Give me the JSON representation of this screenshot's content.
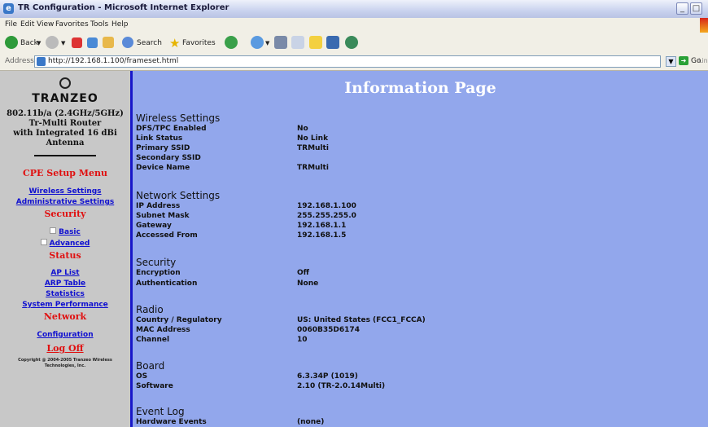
{
  "window": {
    "title": "TR Configuration - Microsoft Internet Explorer",
    "menu": [
      "File",
      "Edit",
      "View",
      "Favorites",
      "Tools",
      "Help"
    ]
  },
  "toolbar": {
    "back": "Back",
    "search": "Search",
    "favorites": "Favorites"
  },
  "address": {
    "label": "Address",
    "url": "http://192.168.1.100/frameset.html",
    "go": "Go",
    "links": "Links"
  },
  "sidebar": {
    "logo": "TRANZEO",
    "product": [
      "802.11b/a (2.4GHz/5GHz)",
      "Tr-Multi Router",
      "with Integrated 16 dBi",
      "Antenna"
    ],
    "cpe_heading": "CPE Setup Menu",
    "wireless_settings": "Wireless Settings",
    "administrative_settings": "Administrative Settings",
    "security_heading": "Security",
    "basic": "Basic",
    "advanced": "Advanced",
    "status_heading": "Status",
    "ap_list": "AP List",
    "arp_table": "ARP Table",
    "statistics": "Statistics",
    "system_performance": "System Performance",
    "network_heading": "Network",
    "configuration": "Configuration",
    "log_off": "Log Off",
    "copyright": [
      "Copyright @ 2004-2005 Tranzeo Wireless",
      "Technologies, Inc."
    ]
  },
  "main": {
    "title": "Information Page",
    "sections": {
      "wireless": {
        "heading": "Wireless Settings",
        "rows": [
          {
            "label": "DFS/TPC Enabled",
            "value": "No"
          },
          {
            "label": "Link Status",
            "value": "No Link"
          },
          {
            "label": "Primary SSID",
            "value": "TRMulti"
          },
          {
            "label": "Secondary SSID",
            "value": ""
          },
          {
            "label": "Device Name",
            "value": "TRMulti"
          }
        ]
      },
      "network": {
        "heading": "Network Settings",
        "rows": [
          {
            "label": "IP Address",
            "value": "192.168.1.100"
          },
          {
            "label": "Subnet Mask",
            "value": "255.255.255.0"
          },
          {
            "label": "Gateway",
            "value": "192.168.1.1"
          },
          {
            "label": "Accessed From",
            "value": "192.168.1.5"
          }
        ]
      },
      "security": {
        "heading": "Security",
        "rows": [
          {
            "label": "Encryption",
            "value": "Off"
          },
          {
            "label": "Authentication",
            "value": "None"
          }
        ]
      },
      "radio": {
        "heading": "Radio",
        "rows": [
          {
            "label": "Country / Regulatory",
            "value": "US: United States (FCC1_FCCA)"
          },
          {
            "label": "MAC Address",
            "value": "0060B35D6174"
          },
          {
            "label": "Channel",
            "value": "10"
          }
        ]
      },
      "board": {
        "heading": "Board",
        "rows": [
          {
            "label": "OS",
            "value": "6.3.34P (1019)"
          },
          {
            "label": "Software",
            "value": "2.10 (TR-2.0.14Multi)"
          }
        ]
      },
      "eventlog": {
        "heading": "Event Log",
        "rows": [
          {
            "label": "Hardware Events",
            "value": "(none)"
          }
        ]
      }
    }
  },
  "colors": {
    "sidebar_bg": "#c8c8c8",
    "main_bg": "#92a7ec",
    "link": "#1010d0",
    "heading_red": "#e01010",
    "sidebar_border": "#1717c9"
  }
}
